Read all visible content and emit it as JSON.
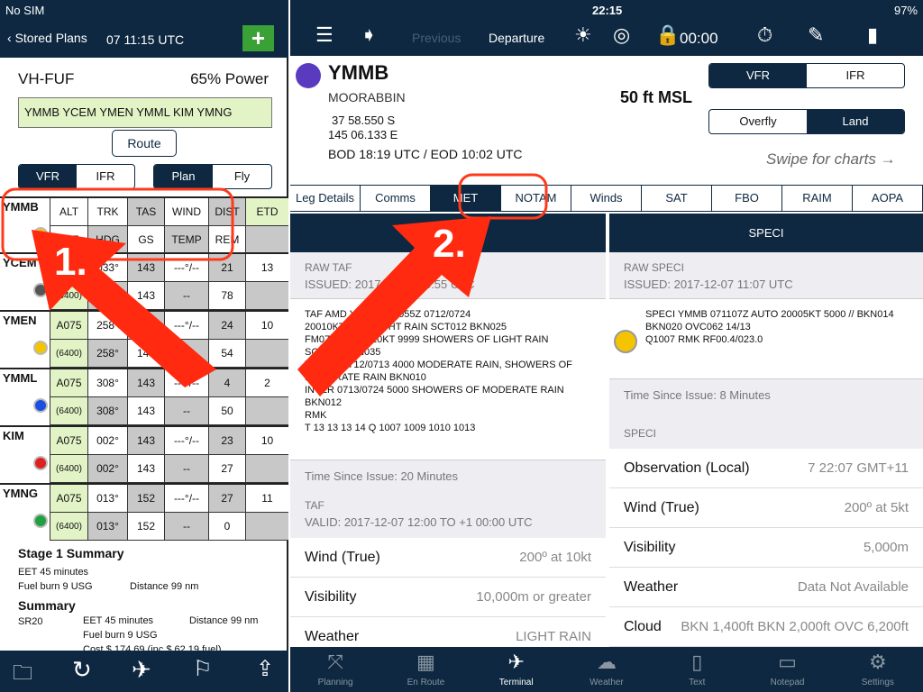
{
  "status": {
    "carrier": "No SIM",
    "time": "22:15",
    "battery": "97%"
  },
  "left": {
    "back_label": "Stored Plans",
    "time": "07 11:15 UTC",
    "add_label": "+",
    "aircraft": "VH-FUF",
    "power": "65% Power",
    "route_string": "YMMB YCEM  YMEN YMML KIM YMNG",
    "route_button": "Route",
    "rules": [
      "VFR",
      "IFR"
    ],
    "mode": [
      "Plan",
      "Fly"
    ],
    "header": {
      "wp": "YMMB",
      "r1": [
        "ALT",
        "TRK",
        "TAS",
        "WIND",
        "DIST",
        "ETD"
      ],
      "r2": [
        "ALT",
        "HDG",
        "GS",
        "TEMP",
        "REM",
        ""
      ]
    },
    "waypoints": [
      {
        "name": "YCEM",
        "dot": "#555555",
        "alt": "A075",
        "alt2": "(6400)",
        "trk": "033°",
        "hdg": "033°",
        "tas": "143",
        "gs": "143",
        "wind": "---°/--",
        "temp": "--",
        "dist": "21",
        "rem": "78",
        "etd": "13"
      },
      {
        "name": "YMEN",
        "dot": "#f5c400",
        "alt": "A075",
        "alt2": "(6400)",
        "trk": "258°",
        "hdg": "258°",
        "tas": "143",
        "gs": "143",
        "wind": "---°/--",
        "temp": "--",
        "dist": "24",
        "rem": "54",
        "etd": "10"
      },
      {
        "name": "YMML",
        "dot": "#1a4fe0",
        "alt": "A075",
        "alt2": "(6400)",
        "trk": "308°",
        "hdg": "308°",
        "tas": "143",
        "gs": "143",
        "wind": "---°/--",
        "temp": "--",
        "dist": "4",
        "rem": "50",
        "etd": "2"
      },
      {
        "name": "KIM",
        "dot": "#e02020",
        "alt": "A075",
        "alt2": "(6400)",
        "trk": "002°",
        "hdg": "002°",
        "tas": "143",
        "gs": "143",
        "wind": "---°/--",
        "temp": "--",
        "dist": "23",
        "rem": "27",
        "etd": "10"
      },
      {
        "name": "YMNG",
        "dot": "#20a040",
        "alt": "A075",
        "alt2": "(6400)",
        "trk": "013°",
        "hdg": "013°",
        "tas": "152",
        "gs": "152",
        "wind": "---°/--",
        "temp": "--",
        "dist": "27",
        "rem": "0",
        "etd": "11"
      }
    ],
    "stage_title": "Stage 1 Summary",
    "stage_eet": "EET 45 minutes",
    "stage_fuel": "Fuel burn 9 USG",
    "stage_dist": "Distance 99 nm",
    "summary_title": "Summary",
    "summary_ac": "SR20",
    "summary_eet": "EET 45 minutes",
    "summary_dist": "Distance 99 nm",
    "summary_fuel": "Fuel burn 9 USG",
    "summary_cost": "Cost $ 174.69 (inc $ 62.19 fuel)"
  },
  "toolbar": {
    "previous": "Previous",
    "current": "Departure",
    "timer": "00:00"
  },
  "airport": {
    "code": "YMMB",
    "name": "MOORABBIN",
    "lat": "37 58.550 S",
    "lon": "145 06.133 E",
    "elevation": "50 ft MSL",
    "bod": "BOD 18:19 UTC / EOD 10:02 UTC",
    "rules": [
      "VFR",
      "IFR"
    ],
    "action": [
      "Overfly",
      "Land"
    ],
    "swipe": "Swipe for charts →"
  },
  "tabs": [
    "Leg Details",
    "Comms",
    "MET",
    "NOTAM",
    "Winds",
    "SAT",
    "FBO",
    "RAIM",
    "AOPA"
  ],
  "taf": {
    "raw_label": "RAW TAF",
    "issued": "ISSUED: 2017-12-07 10:55 UTC",
    "raw_lines": [
      "TAF AMD YMMB 071055Z 0712/0724",
      "20010KT 9999 LIGHT RAIN SCT012 BKN025",
      "FM071300 24010KT 9999 SHOWERS OF LIGHT RAIN",
      "SCT020 BKN035",
      "TEMPO 0712/0713 4000 MODERATE RAIN, SHOWERS OF",
      "MODERATE RAIN BKN010",
      "INTER 0713/0724 5000 SHOWERS OF MODERATE RAIN",
      "BKN012",
      "RMK",
      "T 13 13 13 14 Q 1007 1009 1010 1013"
    ],
    "since": "Time Since Issue: 20 Minutes",
    "section": "TAF",
    "valid": "VALID: 2017-12-07 12:00 TO +1 00:00 UTC",
    "rows": [
      {
        "k": "Wind (True)",
        "v": "200º at 10kt"
      },
      {
        "k": "Visibility",
        "v": "10,000m or greater"
      },
      {
        "k": "Weather",
        "v": "LIGHT RAIN"
      }
    ]
  },
  "speci": {
    "title": "SPECI",
    "raw_label": "RAW SPECI",
    "issued": "ISSUED: 2017-12-07 11:07 UTC",
    "raw_lines": [
      "SPECI YMMB 071107Z AUTO 20005KT 5000 // BKN014",
      "BKN020 OVC062 14/13",
      "Q1007 RMK RF00.4/023.0"
    ],
    "dot": "#f5c400",
    "since": "Time Since Issue: 8 Minutes",
    "section": "SPECI",
    "rows": [
      {
        "k": "Observation (Local)",
        "v": "7 22:07 GMT+11"
      },
      {
        "k": "Wind (True)",
        "v": "200º at 5kt"
      },
      {
        "k": "Visibility",
        "v": "5,000m"
      },
      {
        "k": "Weather",
        "v": "Data Not Available"
      },
      {
        "k": "Cloud",
        "v": "BKN 1,400ft BKN 2,000ft OVC 6,200ft"
      }
    ]
  },
  "bottom_tabs": [
    {
      "label": "Planning",
      "icon": "route-icon"
    },
    {
      "label": "En Route",
      "icon": "map-icon"
    },
    {
      "label": "Terminal",
      "icon": "airplane-icon"
    },
    {
      "label": "Weather",
      "icon": "cloud-icon"
    },
    {
      "label": "Text",
      "icon": "book-icon"
    },
    {
      "label": "Notepad",
      "icon": "notepad-icon"
    },
    {
      "label": "Settings",
      "icon": "gear-icon"
    }
  ],
  "annotations": {
    "one": "1.",
    "two": "2.",
    "color": "#ff2a10"
  }
}
